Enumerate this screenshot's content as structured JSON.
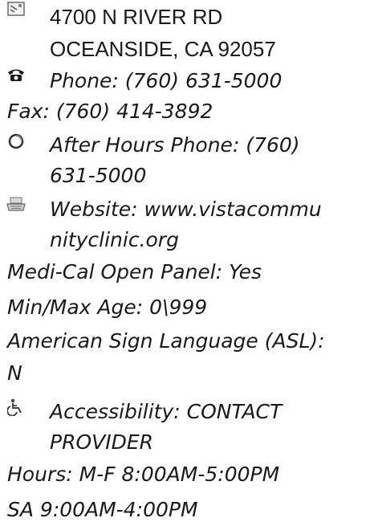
{
  "address": {
    "line1": "4700 N RIVER RD",
    "line2": "OCEANSIDE, CA 92057"
  },
  "phone": "Phone: (760) 631-5000",
  "fax": "Fax: (760) 414-3892",
  "after_hours": {
    "line1": "After Hours Phone: (760)",
    "line2": "631-5000"
  },
  "website": {
    "line1": "Website: www.vistacommu",
    "line2": "nityclinic.org"
  },
  "medi_cal": "Medi-Cal Open Panel: Yes",
  "age_range": "Min/Max Age: 0\\999",
  "asl": {
    "line1": "American Sign Language (ASL):",
    "line2": "N"
  },
  "accessibility": {
    "line1": "Accessibility: CONTACT",
    "line2": "PROVIDER"
  },
  "hours": {
    "line1": "Hours: M-F 8:00AM-5:00PM",
    "line2": "SA 9:00AM-4:00PM"
  },
  "icons": {
    "address": "map-icon",
    "phone": "telephone-icon",
    "after_hours": "clock-icon",
    "website": "keyboard-icon",
    "accessibility": "wheelchair-icon"
  }
}
